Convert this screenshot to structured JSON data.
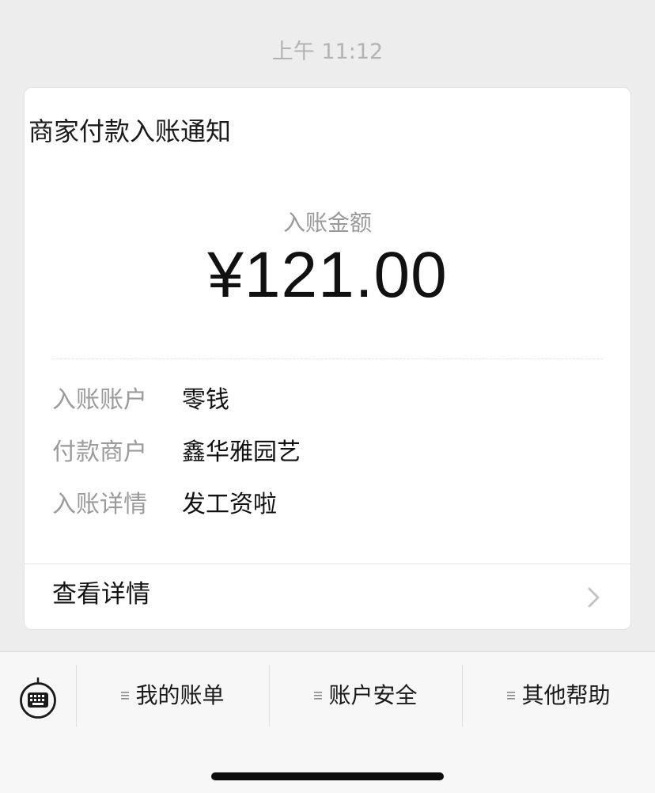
{
  "timestamp": "上午 11:12",
  "card": {
    "title": "商家付款入账通知",
    "amount_label": "入账金额",
    "amount_value": "¥121.00",
    "rows": [
      {
        "label": "入账账户",
        "value": "零钱"
      },
      {
        "label": "付款商户",
        "value": "鑫华雅园艺"
      },
      {
        "label": "入账详情",
        "value": "发工资啦"
      }
    ],
    "detail_link": "查看详情"
  },
  "menu": {
    "items": [
      {
        "label": "我的账单",
        "icon": "menu-lines-icon"
      },
      {
        "label": "账户安全",
        "icon": "menu-lines-icon"
      },
      {
        "label": "其他帮助",
        "icon": "menu-lines-icon"
      }
    ],
    "keyboard_icon": "keyboard-icon"
  },
  "colors": {
    "background": "#ededed",
    "card": "#ffffff",
    "muted_text": "#9b9b9b",
    "primary_text": "#111111"
  }
}
